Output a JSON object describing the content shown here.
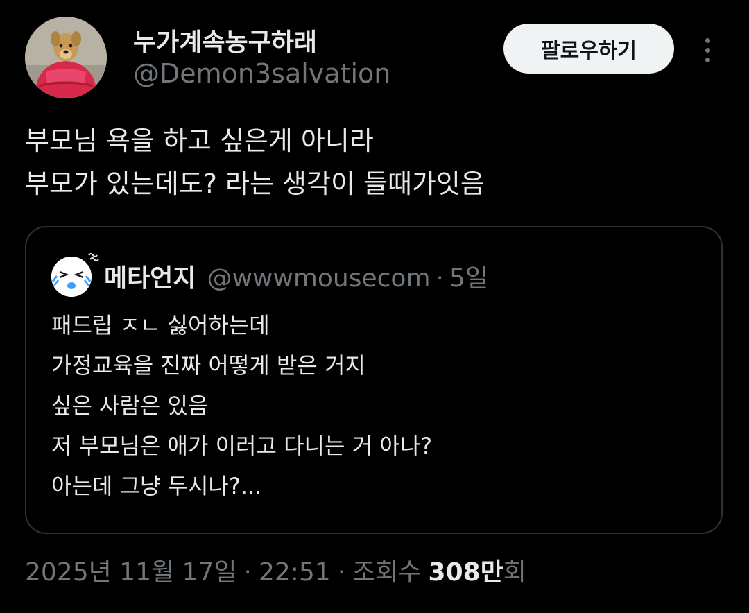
{
  "author": {
    "display_name": "누가계속농구하래",
    "handle": "@Demon3salvation",
    "avatar_icon": "dog-in-red-jacket-avatar"
  },
  "follow_button": {
    "label": "팔로우하기"
  },
  "more_icon": "more-vertical-icon",
  "tweet": {
    "lines": [
      "부모님 욕을 하고 싶은게 아니라",
      "부모가 있는데도? 라는 생각이 들때가잇음"
    ]
  },
  "quoted_tweet": {
    "display_name": "메타언지",
    "handle": "@wwwmousecom",
    "separator": "·",
    "time": "5일",
    "avatar_icon": "crying-face-avatar",
    "lines": [
      "패드립 ㅈㄴ 싫어하는데",
      "가정교육을 진짜 어떻게 받은 거지",
      "싶은 사람은 있음",
      "저 부모님은 애가 이러고 다니는 거 아나?",
      "아는데 그냥 두시나?..."
    ]
  },
  "meta": {
    "date": "2025년 11월 17일",
    "separator": "·",
    "time": "22:51",
    "views_label": "조회수",
    "views_count": "308만",
    "views_suffix": "회"
  },
  "colors": {
    "background": "#000000",
    "primary_text": "#e7e9ea",
    "secondary_text": "#71767b",
    "border": "#2f3336",
    "follow_button_bg": "#eff3f4"
  }
}
